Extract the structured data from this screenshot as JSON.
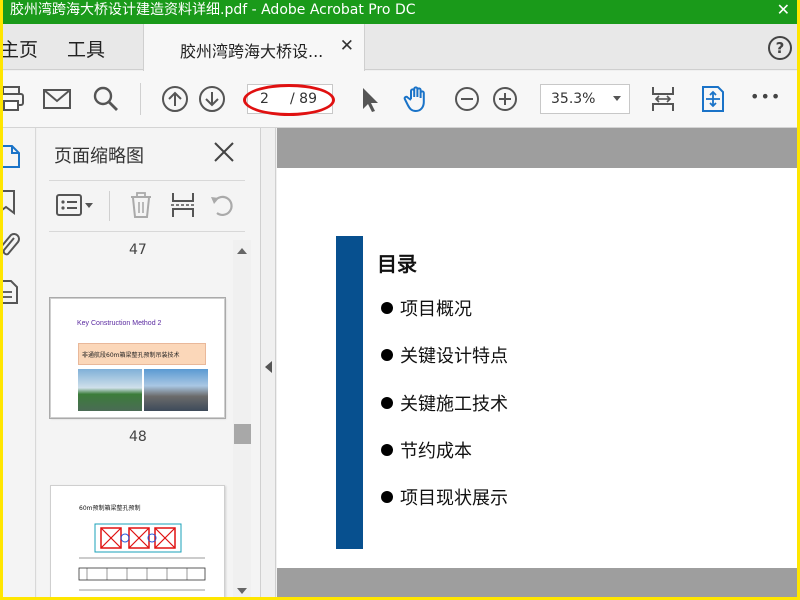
{
  "window": {
    "title": "胶州湾跨海大桥设计建造资料详细.pdf - Adobe Acrobat Pro DC",
    "close_glyph": "✕"
  },
  "menu": {
    "home": "主页",
    "tools": "工具"
  },
  "tab": {
    "label": "胶州湾跨海大桥设...",
    "close_glyph": "✕"
  },
  "help_glyph": "?",
  "toolbar": {
    "current_page": "2",
    "total_pages": "/ 89",
    "zoom": "35.3%",
    "more_glyph": "•••"
  },
  "thumbnails": {
    "title": "页面缩略图",
    "pages": [
      {
        "number": "47"
      },
      {
        "number": "48"
      }
    ],
    "card1": {
      "heading": "Key Construction Method 2",
      "banner": "非通航段60m箱梁整孔预制吊装技术"
    },
    "card2": {
      "heading": "60m预制箱梁整孔预制"
    }
  },
  "slide": {
    "heading": "目录",
    "items": [
      "项目概况",
      "关键设计特点",
      "关键施工技术",
      "节约成本",
      "项目现状展示"
    ]
  },
  "colors": {
    "titlebar": "#1a9a1a",
    "accent_blue": "#07508f",
    "annotation_red": "#e01010",
    "border_yellow": "#ffe600"
  }
}
